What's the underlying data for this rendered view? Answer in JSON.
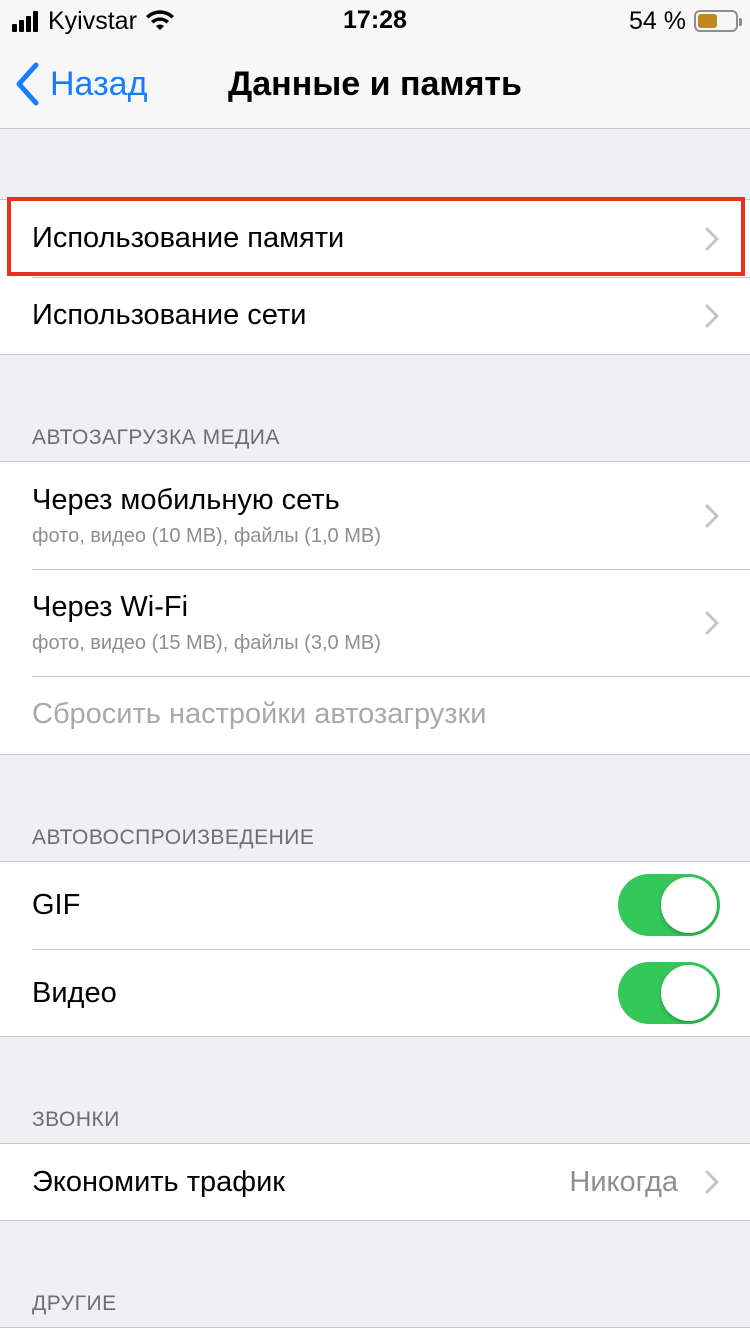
{
  "status_bar": {
    "carrier": "Kyivstar",
    "time": "17:28",
    "battery_percent": "54 %",
    "battery_level": 0.54,
    "battery_color": "#c1891a"
  },
  "nav": {
    "back_label": "Назад",
    "title": "Данные и память"
  },
  "storage_group": {
    "items": [
      {
        "label": "Использование памяти"
      },
      {
        "label": "Использование сети"
      }
    ]
  },
  "autoload": {
    "header": "АВТОЗАГРУЗКА МЕДИА",
    "items": [
      {
        "label": "Через мобильную сеть",
        "sub": "фото, видео (10 MB), файлы (1,0 MB)"
      },
      {
        "label": "Через Wi-Fi",
        "sub": "фото, видео (15 MB), файлы (3,0 MB)"
      }
    ],
    "reset_label": "Сбросить настройки автозагрузки"
  },
  "autoplay": {
    "header": "АВТОВОСПРОИЗВЕДЕНИЕ",
    "items": [
      {
        "label": "GIF",
        "on": true
      },
      {
        "label": "Видео",
        "on": true
      }
    ]
  },
  "calls": {
    "header": "ЗВОНКИ",
    "items": [
      {
        "label": "Экономить трафик",
        "value": "Никогда"
      }
    ]
  },
  "other": {
    "header": "ДРУГИЕ"
  },
  "colors": {
    "accent": "#157efb",
    "toggle_on": "#34c759",
    "highlight": "#e8321f"
  }
}
